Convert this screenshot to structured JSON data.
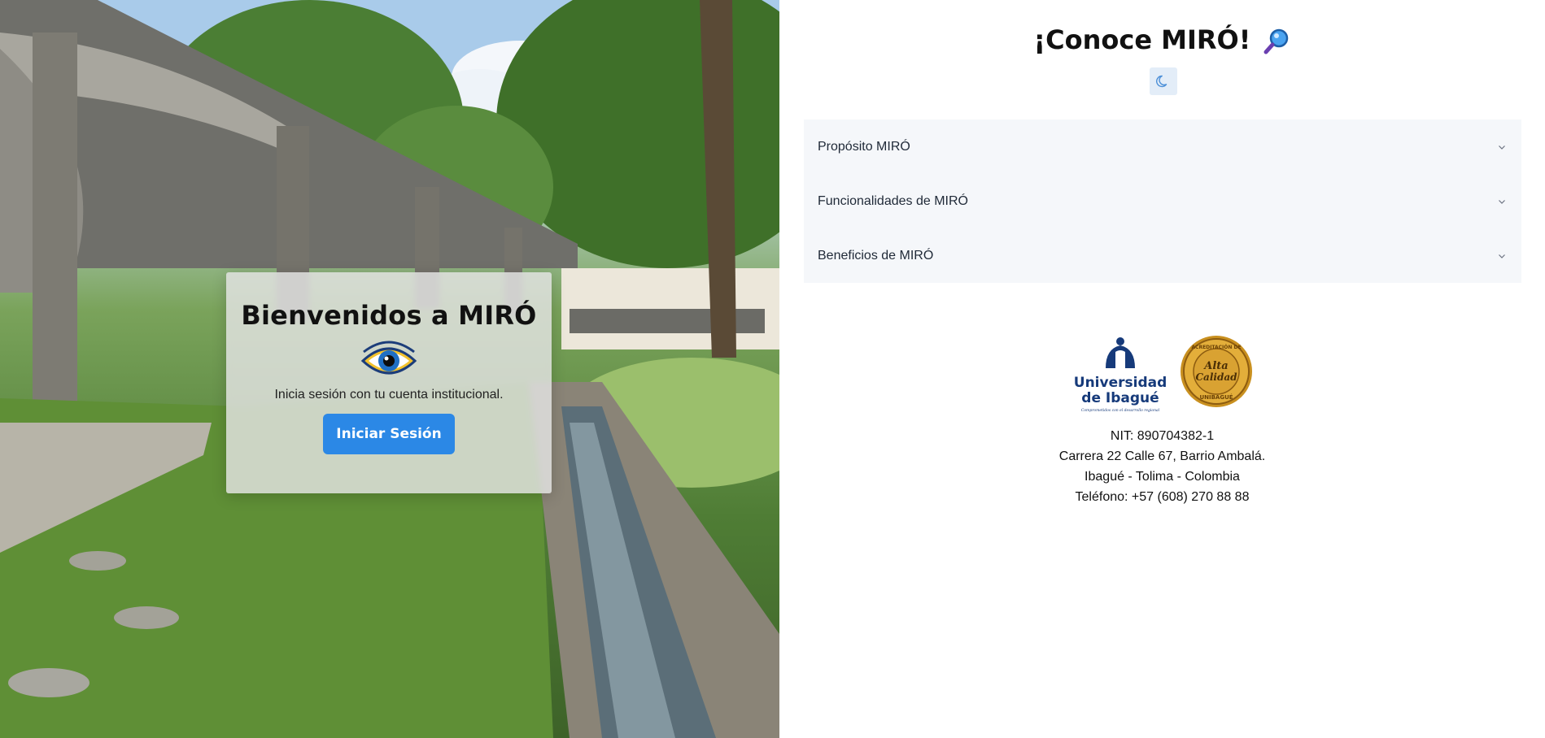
{
  "hero": {
    "card_title": "Bienvenidos a MIRÓ",
    "card_subtitle": "Inicia sesión con tu cuenta institucional.",
    "login_button_label": "Iniciar Sesión",
    "logo_icon": "eye-icon"
  },
  "info": {
    "title": "¡Conoce MIRÓ!",
    "title_icon": "magnifying-glass-icon",
    "theme_toggle_icon": "moon-icon",
    "accordion": [
      {
        "label": "Propósito MIRÓ"
      },
      {
        "label": "Funcionalidades de MIRÓ"
      },
      {
        "label": "Beneficios de MIRÓ"
      }
    ],
    "university_logo": {
      "line1": "Universidad",
      "line2": "de Ibagué",
      "tagline": "Comprometidos con el desarrollo regional"
    },
    "accreditation_seal": {
      "top": "ACREDITACIÓN DE",
      "center1": "Alta",
      "center2": "Calidad",
      "bottom": "UNIBAGUÉ"
    },
    "address": {
      "nit": "NIT: 890704382-1",
      "street": "Carrera 22 Calle 67, Barrio Ambalá.",
      "city": "Ibagué - Tolima - Colombia",
      "phone": "Teléfono: +57 (608) 270 88 88"
    }
  },
  "colors": {
    "primary_button": "#2b88e6",
    "accordion_bg": "#f5f7fa",
    "university_blue": "#163a7a",
    "seal_gold": "#c9901f"
  }
}
